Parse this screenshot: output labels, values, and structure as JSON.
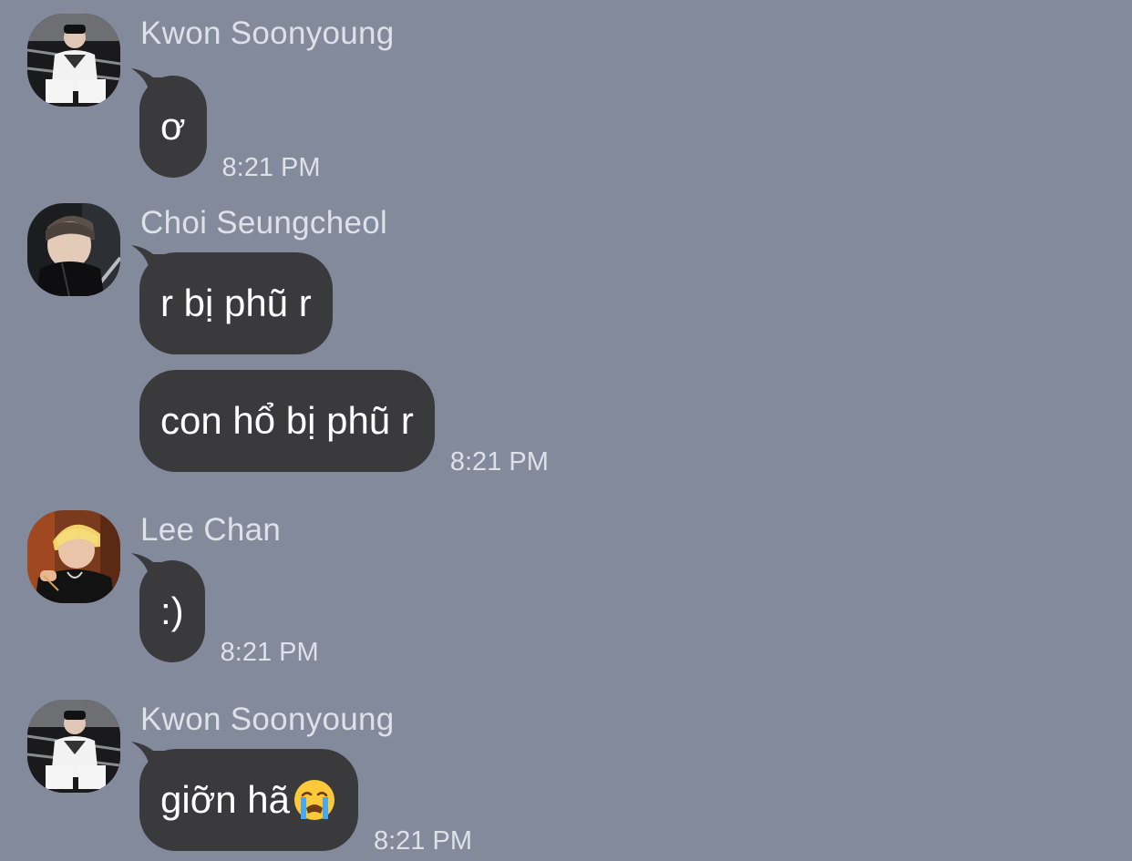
{
  "colors": {
    "background": "#828a9b",
    "bubble": "#3a3a3c",
    "bubble_text": "#ffffff",
    "meta_text": "#dde1e8"
  },
  "messages": [
    {
      "sender": "Kwon Soonyoung",
      "avatar": "photo-avatar",
      "bubbles": [
        {
          "text": "ơ",
          "time": "8:21 PM"
        }
      ]
    },
    {
      "sender": "Choi Seungcheol",
      "avatar": "photo-avatar",
      "bubbles": [
        {
          "text": "r bị phũ r",
          "time": ""
        },
        {
          "text": "con hổ bị phũ r",
          "time": "8:21 PM"
        }
      ]
    },
    {
      "sender": "Lee Chan",
      "avatar": "photo-avatar",
      "bubbles": [
        {
          "text": ":)",
          "time": "8:21 PM"
        }
      ]
    },
    {
      "sender": "Kwon Soonyoung",
      "avatar": "photo-avatar",
      "bubbles": [
        {
          "text": "giỡn hã",
          "emoji": "loudly-crying-face-icon",
          "time": "8:21 PM"
        }
      ]
    }
  ]
}
